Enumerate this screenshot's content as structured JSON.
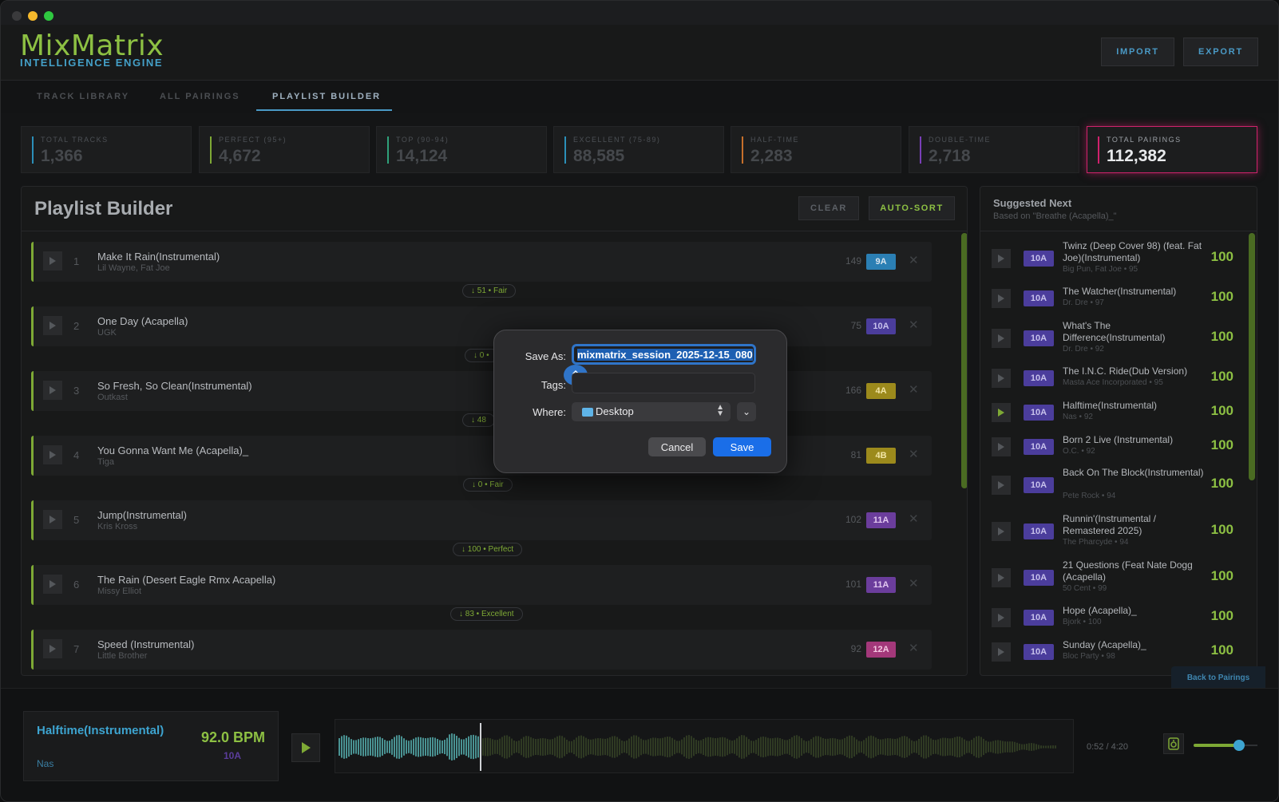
{
  "app": {
    "logo_main": "MixMatrix",
    "logo_sub": "INTELLIGENCE ENGINE",
    "import_label": "IMPORT",
    "export_label": "EXPORT"
  },
  "tabs": [
    {
      "label": "TRACK LIBRARY"
    },
    {
      "label": "ALL PAIRINGS"
    },
    {
      "label": "PLAYLIST BUILDER"
    }
  ],
  "stats": [
    {
      "label": "TOTAL TRACKS",
      "value": "1,366",
      "color": "#2b8fb8"
    },
    {
      "label": "PERFECT (95+)",
      "value": "4,672",
      "color": "#7ea935"
    },
    {
      "label": "TOP (90-94)",
      "value": "14,124",
      "color": "#2fa07a"
    },
    {
      "label": "EXCELLENT (75-89)",
      "value": "88,585",
      "color": "#2b8fb8"
    },
    {
      "label": "HALF-TIME",
      "value": "2,283",
      "color": "#c7702b"
    },
    {
      "label": "DOUBLE-TIME",
      "value": "2,718",
      "color": "#7a3fb8"
    },
    {
      "label": "TOTAL PAIRINGS",
      "value": "112,382",
      "color": "#d0226c"
    }
  ],
  "playlist": {
    "title": "Playlist Builder",
    "clear_label": "CLEAR",
    "autosort_label": "AUTO-SORT",
    "tracks": [
      {
        "num": "1",
        "title": "Make It Rain(Instrumental)",
        "artist": "Lil Wayne, Fat Joe",
        "bpm": "149",
        "key": "9A",
        "key_color": "#2b7fb4"
      },
      {
        "num": "2",
        "title": "One Day (Acapella)",
        "artist": "UGK",
        "bpm": "75",
        "key": "10A",
        "key_color": "#4b3d9c"
      },
      {
        "num": "3",
        "title": "So Fresh, So Clean(Instrumental)",
        "artist": "Outkast",
        "bpm": "166",
        "key": "4A",
        "key_color": "#9c8a1c"
      },
      {
        "num": "4",
        "title": "You Gonna Want Me (Acapella)_",
        "artist": "Tiga",
        "bpm": "81",
        "key": "4B",
        "key_color": "#9c8a1c"
      },
      {
        "num": "5",
        "title": "Jump(Instrumental)",
        "artist": "Kris Kross",
        "bpm": "102",
        "key": "11A",
        "key_color": "#6b3d9c"
      },
      {
        "num": "6",
        "title": "The Rain (Desert Eagle Rmx Acapella)",
        "artist": "Missy Elliot",
        "bpm": "101",
        "key": "11A",
        "key_color": "#6b3d9c"
      },
      {
        "num": "7",
        "title": "Speed (Instrumental)",
        "artist": "Little Brother",
        "bpm": "92",
        "key": "12A",
        "key_color": "#a3387a"
      }
    ],
    "transitions": [
      "↓ 51 • Fair",
      "↓ 0 •",
      "↓ 48",
      "↓ 0 • Fair",
      "↓ 100 • Perfect",
      "↓ 83 • Excellent"
    ]
  },
  "suggested": {
    "title": "Suggested Next",
    "subtitle": "Based on \"Breathe (Acapella)_\"",
    "items": [
      {
        "title": "Twinz (Deep Cover 98) (feat. Fat Joe)(Instrumental)",
        "meta": "Big Pun, Fat Joe • 95",
        "key": "10A",
        "score": "100"
      },
      {
        "title": "The Watcher(Instrumental)",
        "meta": "Dr. Dre • 97",
        "key": "10A",
        "score": "100"
      },
      {
        "title": "What's The Difference(Instrumental)",
        "meta": "Dr. Dre • 92",
        "key": "10A",
        "score": "100"
      },
      {
        "title": "The I.N.C. Ride(Dub Version)",
        "meta": "Masta Ace Incorporated • 95",
        "key": "10A",
        "score": "100"
      },
      {
        "title": "Halftime(Instrumental)",
        "meta": "Nas • 92",
        "key": "10A",
        "score": "100"
      },
      {
        "title": "Born 2 Live (Instrumental)",
        "meta": "O.C. • 92",
        "key": "10A",
        "score": "100"
      },
      {
        "title": "Back On The Block(Instrumental)",
        "meta": "Pete Rock • 94",
        "key": "10A",
        "score": "100"
      },
      {
        "title": "Runnin'(Instrumental / Remastered 2025)",
        "meta": "The Pharcyde • 94",
        "key": "10A",
        "score": "100"
      },
      {
        "title": "21 Questions (Feat Nate Dogg (Acapella)",
        "meta": "50 Cent • 99",
        "key": "10A",
        "score": "100"
      },
      {
        "title": "Hope (Acapella)_",
        "meta": "Bjork • 100",
        "key": "10A",
        "score": "100"
      },
      {
        "title": "Sunday (Acapella)_",
        "meta": "Bloc Party • 98",
        "key": "10A",
        "score": "100"
      }
    ],
    "back_label": "Back to Pairings"
  },
  "player": {
    "title": "Halftime(Instrumental)",
    "artist": "Nas",
    "bpm": "92.0 BPM",
    "key": "10A",
    "time": "0:52 / 4:20",
    "progress": 0.2,
    "volume": 0.75
  },
  "dialog": {
    "save_as_label": "Save As:",
    "filename": "mixmatrix_session_2025-12-15_080",
    "tags_label": "Tags:",
    "where_label": "Where:",
    "where_value": "Desktop",
    "cancel_label": "Cancel",
    "save_label": "Save"
  }
}
